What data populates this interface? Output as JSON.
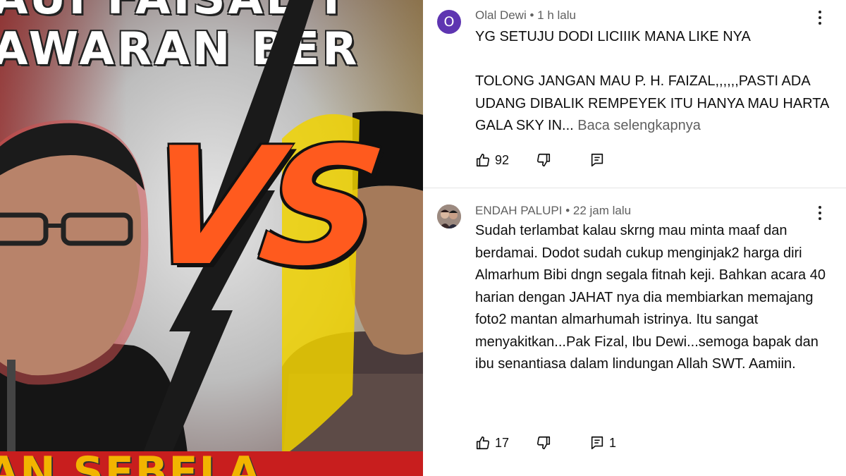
{
  "thumbnail": {
    "top_text_line1": "AUI FAISAL T",
    "top_text_line2": "AWARAN BER",
    "vs_text": "VS",
    "bottom_text": "AN SEBELA"
  },
  "colors": {
    "avatar_purple": "#5e35b1",
    "vs_orange": "#ff5a1e",
    "text_primary": "#0f0f0f",
    "text_secondary": "#606060"
  },
  "comments": [
    {
      "avatar_letter": "O",
      "author": "Olal Dewi",
      "time": "1 h lalu",
      "text": "YG SETUJU DODI LICIIIK MANA LIKE NYA\n\nTOLONG JANGAN MAU P. H. FAIZAL,,,,,,PASTI ADA UDANG DIBALIK REMPEYEK ITU HANYA MAU HARTA GALA SKY IN...",
      "read_more": "Baca selengkapnya",
      "likes": "92",
      "replies": ""
    },
    {
      "avatar_letter": "",
      "author": "ENDAH PALUPI",
      "time": "22 jam lalu",
      "text": "Sudah terlambat kalau skrng mau minta maaf dan berdamai. Dodot sudah cukup menginjak2 harga diri Almarhum Bibi dngn segala fitnah keji. Bahkan acara 40 harian dengan JAHAT nya dia membiarkan memajang foto2 mantan almarhumah istrinya. Itu sangat menyakitkan...Pak Fizal, Ibu Dewi...semoga bapak dan ibu senantiasa dalam lindungan Allah SWT. Aamiin.",
      "read_more": "",
      "likes": "17",
      "replies": "1"
    }
  ]
}
